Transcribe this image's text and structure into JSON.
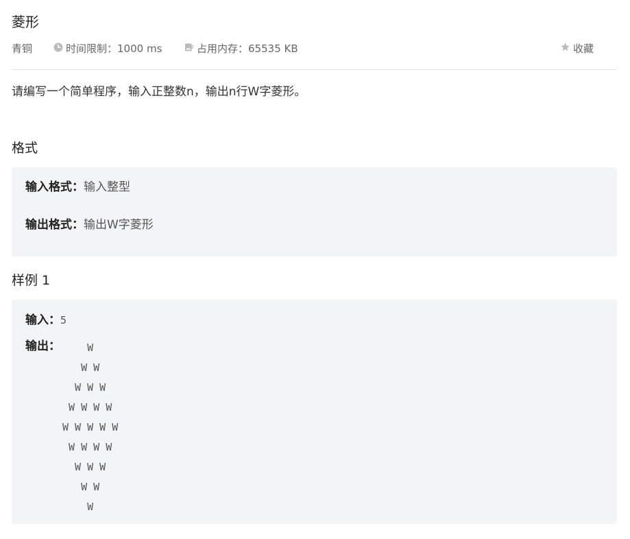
{
  "problem": {
    "title": "菱形",
    "difficulty": "青铜",
    "time_limit_label": "时间限制：",
    "time_limit_value": "1000 ms",
    "memory_limit_label": "占用内存：",
    "memory_limit_value": "65535 KB",
    "favorite_label": "收藏",
    "description": "请编写一个简单程序，输入正整数n，输出n行W字菱形。"
  },
  "format": {
    "heading": "格式",
    "input_label": "输入格式：",
    "input_value": "输入整型",
    "output_label": "输出格式：",
    "output_value": "输出W字菱形"
  },
  "sample": {
    "heading": "样例 1",
    "input_label": "输入：",
    "input_value": "5",
    "output_label": "输出：",
    "output_value": "    W\n   W W\n  W W W\n W W W W\nW W W W W\n W W W W\n  W W W\n   W W\n    W"
  },
  "icons": {
    "clock": "clock-icon",
    "memory": "memory-icon",
    "star": "star-icon"
  },
  "colors": {
    "panel_bg": "#f3f4f6",
    "divider": "#e4e4e4",
    "muted_text": "#666666",
    "icon": "#bbbbbb"
  }
}
